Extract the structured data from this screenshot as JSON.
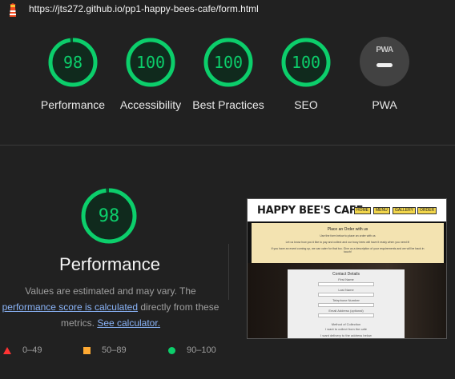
{
  "url": "https://jts272.github.io/pp1-happy-bees-cafe/form.html",
  "categories": [
    {
      "score": "98",
      "label": "Performance",
      "fraction": 0.98
    },
    {
      "score": "100",
      "label": "Accessibility",
      "fraction": 1.0
    },
    {
      "score": "100",
      "label": "Best Practices",
      "fraction": 1.0
    },
    {
      "score": "100",
      "label": "SEO",
      "fraction": 1.0
    }
  ],
  "pwa": {
    "badge_text": "PWA",
    "label": "PWA"
  },
  "performance": {
    "score": "98",
    "fraction": 0.98,
    "title": "Performance",
    "desc_part1": "Values are estimated and may vary. The",
    "desc_link1": "performance score is calculated",
    "desc_part2": "directly from these metrics.",
    "desc_link2": "See calculator."
  },
  "legend": [
    {
      "shape": "triangle",
      "range": "0–49",
      "color": "#ff3333"
    },
    {
      "shape": "square",
      "range": "50–89",
      "color": "#ffaa33"
    },
    {
      "shape": "circle",
      "range": "90–100",
      "color": "#0cce6b"
    }
  ],
  "screenshot": {
    "brand": "HAPPY BEE'S CAFE",
    "nav": [
      "HOME",
      "MENU",
      "GALLERY",
      "ORDER"
    ],
    "panel_title": "Place an Order with us",
    "panel_line1": "Use the form below to place an order with us",
    "panel_line2": "Let us know how you'd like to pay and collect and our busy bees will have it ready when you need it!",
    "panel_line3": "If you have an event coming up, we can cater for that too. Give us a description of your requirements and we will be back in touch!",
    "form_title": "Contact Details",
    "form_fields": [
      "First Name",
      "Last Name",
      "Telephone Number",
      "Email Address (optional)"
    ],
    "form_section": "Method of Collection",
    "form_option1": "I want to collect from the cafe",
    "form_option2": "I want delivery to the address below"
  },
  "colors": {
    "pass": "#0cce6b",
    "pass_track": "#0a4a2b",
    "background": "#212121"
  }
}
